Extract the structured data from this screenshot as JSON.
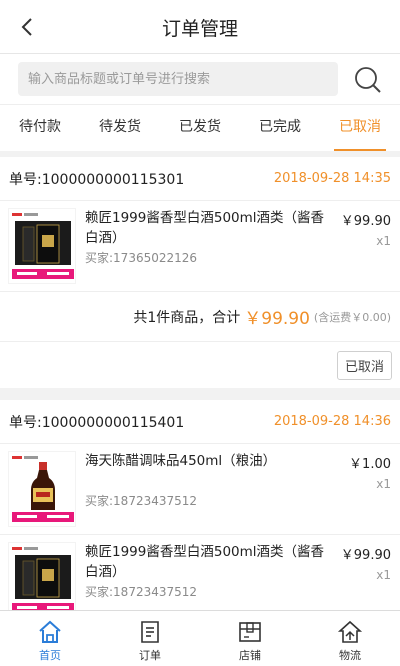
{
  "header": {
    "title": "订单管理",
    "back_icon": "chevron-left-icon"
  },
  "search": {
    "placeholder": "输入商品标题或订单号进行搜索",
    "icon": "search-icon"
  },
  "tabs": [
    {
      "label": "待付款",
      "active": false
    },
    {
      "label": "待发货",
      "active": false
    },
    {
      "label": "已发货",
      "active": false
    },
    {
      "label": "已完成",
      "active": false
    },
    {
      "label": "已取消",
      "active": true
    }
  ],
  "orders": [
    {
      "order_no": "单号:1000000000115301",
      "time": "2018-09-28 14:35",
      "items": [
        {
          "name": "赖匠1999酱香型白酒500ml酒类（酱香白酒）",
          "buyer": "买家:17365022126",
          "price": "￥99.90",
          "qty": "x1"
        }
      ],
      "summary": {
        "text": "共1件商品，合计",
        "amount": "￥99.90",
        "freight": "(含运费￥0.00)"
      },
      "status_button": "已取消"
    },
    {
      "order_no": "单号:1000000000115401",
      "time": "2018-09-28 14:36",
      "items": [
        {
          "name": "海天陈醋调味品450ml（粮油）",
          "buyer": "买家:18723437512",
          "price": "￥1.00",
          "qty": "x1"
        },
        {
          "name": "赖匠1999酱香型白酒500ml酒类（酱香白酒）",
          "buyer": "买家:18723437512",
          "price": "￥99.90",
          "qty": "x1"
        }
      ]
    }
  ],
  "tabbar": [
    {
      "label": "首页",
      "icon": "home-icon",
      "active": true
    },
    {
      "label": "订单",
      "icon": "order-list-icon",
      "active": false
    },
    {
      "label": "店铺",
      "icon": "store-icon",
      "active": false
    },
    {
      "label": "物流",
      "icon": "logistics-icon",
      "active": false
    }
  ],
  "colors": {
    "accent": "#f0902a",
    "tabbar_active": "#2b7dd8"
  }
}
